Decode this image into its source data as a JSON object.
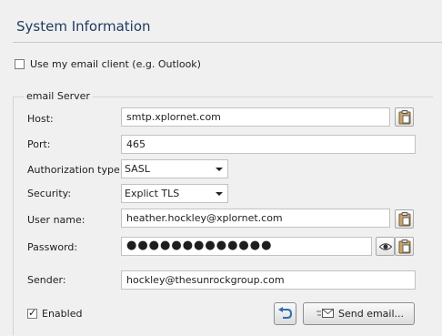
{
  "page": {
    "title": "System Information"
  },
  "use_client": {
    "label": "Use my email client (e.g. Outlook)",
    "checked": false
  },
  "group": {
    "legend": "email Server"
  },
  "host": {
    "label": "Host:",
    "value": "smtp.xplornet.com"
  },
  "port": {
    "label": "Port:",
    "value": "465"
  },
  "auth": {
    "label": "Authorization type:",
    "value": "SASL"
  },
  "security": {
    "label": "Security:",
    "value": "Explict TLS"
  },
  "username": {
    "label": "User name:",
    "value": "heather.hockley@xplornet.com"
  },
  "password": {
    "label": "Password:",
    "value": "●●●●●●●●●●●●●"
  },
  "sender": {
    "label": "Sender:",
    "value": "hockley@thesunrockgroup.com"
  },
  "enabled": {
    "label": "Enabled",
    "checked": true
  },
  "buttons": {
    "send_label": "Send email..."
  },
  "icons": {
    "paste": "clipboard-paste-icon",
    "show_password": "eye-icon",
    "reset": "undo-arrow-icon",
    "send": "envelope-icon"
  }
}
